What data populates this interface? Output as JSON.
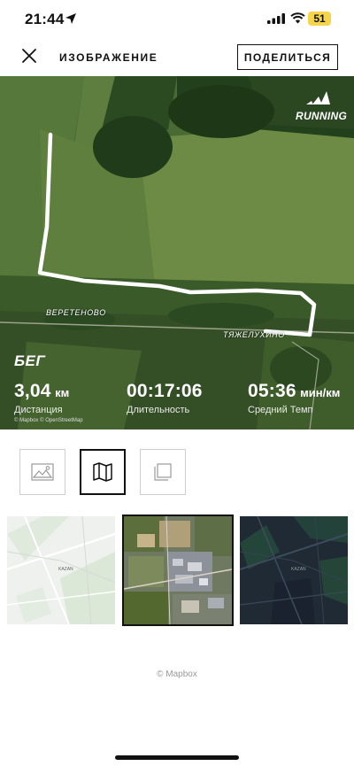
{
  "status_bar": {
    "time": "21:44",
    "battery": "51"
  },
  "header": {
    "title": "ИЗОБРАЖЕНИЕ",
    "share_label": "ПОДЕЛИТЬСЯ"
  },
  "preview": {
    "brand": "RUNNING",
    "activity": "БЕГ",
    "villages": [
      "ВЕРЕТЕНОВО",
      "ТЯЖЕЛУХИНО"
    ],
    "attribution": "© Mapbox  © OpenStreetMap",
    "stats": [
      {
        "value": "3,04",
        "unit": "км",
        "label": "Дистанция"
      },
      {
        "value": "00:17:06",
        "unit": "",
        "label": "Длительность"
      },
      {
        "value": "05:36",
        "unit": "мин/км",
        "label": "Средний Темп"
      }
    ]
  },
  "modes": [
    {
      "icon": "image-icon",
      "selected": false
    },
    {
      "icon": "map-icon",
      "selected": true
    },
    {
      "icon": "layers-icon",
      "selected": false
    }
  ],
  "map_styles": [
    {
      "name": "light",
      "selected": false,
      "place_label": "KAZAN"
    },
    {
      "name": "satellite",
      "selected": true,
      "place_label": ""
    },
    {
      "name": "dark",
      "selected": false,
      "place_label": "KAZAN"
    }
  ],
  "footer": {
    "copyright": "© Mapbox"
  },
  "colors": {
    "route": "#ffffff",
    "brand_text": "#ffffff",
    "accent": "#111111",
    "battery": "#f6d54a"
  }
}
